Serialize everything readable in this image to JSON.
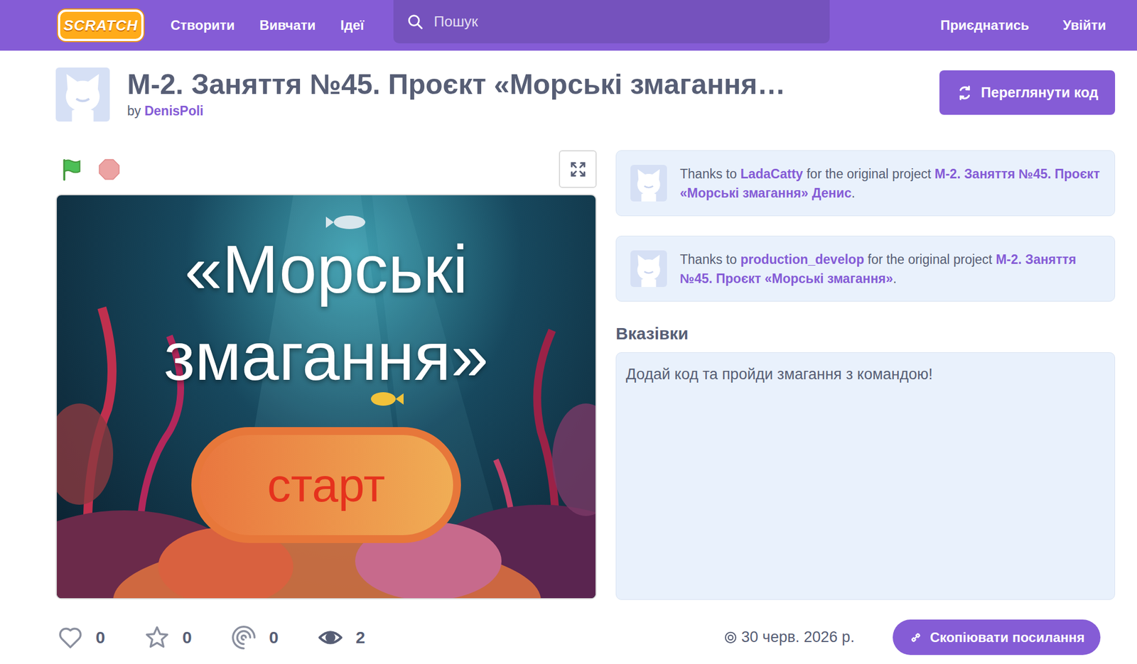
{
  "header": {
    "logo": "SCRATCH",
    "nav": [
      "Створити",
      "Вивчати",
      "Ідеї"
    ],
    "search": {
      "placeholder": "Пошук"
    },
    "join": "Приєднатись",
    "signin": "Увійти"
  },
  "project": {
    "title": "M-2. Заняття №45. Проєкт «Морські змагання…",
    "by": "by",
    "author": "DenisPoli",
    "see_inside": "Переглянути код"
  },
  "stage": {
    "title_lines": [
      "«Морські",
      "змагання»"
    ],
    "start": "старт"
  },
  "credits": [
    {
      "prefix": "Thanks to ",
      "user": "LadaCatty",
      "middle": " for the original project ",
      "project": "M-2. Заняття №45. Проєкт «Морські змагання» Денис",
      "suffix": "."
    },
    {
      "prefix": "Thanks to ",
      "user": "production_develop",
      "middle": " for the original project ",
      "project": "M-2. Заняття №45. Проєкт «Морські змагання»",
      "suffix": "."
    }
  ],
  "instructions": {
    "label": "Вказівки",
    "text": "Додай код та пройди змагання з командою!"
  },
  "stats": [
    {
      "kind": "love",
      "count": "0"
    },
    {
      "kind": "favorite",
      "count": "0"
    },
    {
      "kind": "remix",
      "count": "0"
    },
    {
      "kind": "view",
      "count": "2"
    }
  ],
  "date": "30 черв. 2026 р.",
  "copy_link": "Скопіювати посилання"
}
